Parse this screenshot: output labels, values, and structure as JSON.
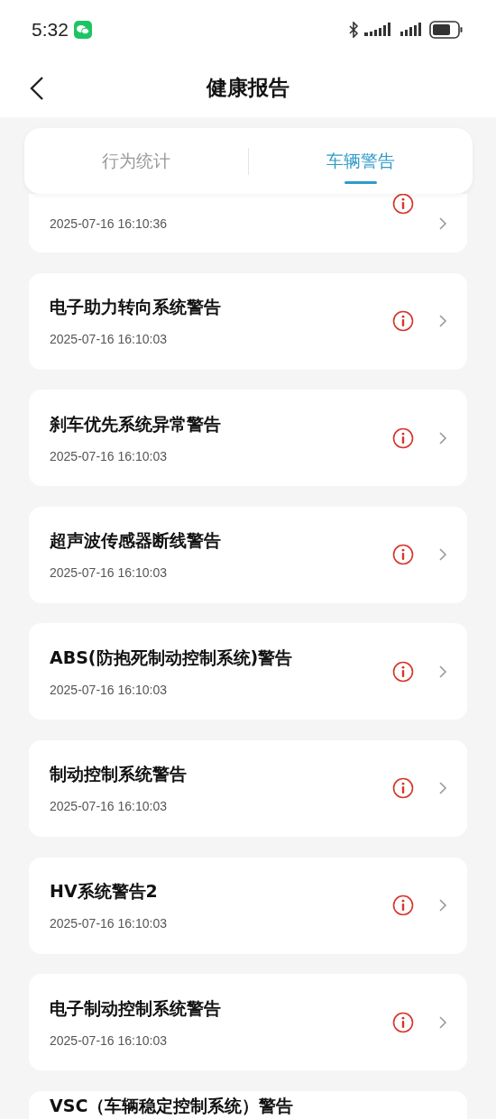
{
  "status_bar": {
    "time": "5:32"
  },
  "header": {
    "title": "健康报告"
  },
  "tabs": [
    {
      "label": "行为统计",
      "selected": false
    },
    {
      "label": "车辆警告",
      "selected": true
    }
  ],
  "warnings": [
    {
      "date": "2025-07-16 16:10:36"
    },
    {
      "title": "电子助力转向系统警告",
      "date": "2025-07-16 16:10:03"
    },
    {
      "title": "刹车优先系统异常警告",
      "date": "2025-07-16 16:10:03"
    },
    {
      "title": "超声波传感器断线警告",
      "date": "2025-07-16 16:10:03"
    },
    {
      "title": "ABS(防抱死制动控制系统)警告",
      "date": "2025-07-16 16:10:03"
    },
    {
      "title": "制动控制系统警告",
      "date": "2025-07-16 16:10:03"
    },
    {
      "title": "HV系统警告2",
      "date": "2025-07-16 16:10:03"
    },
    {
      "title": "电子制动控制系统警告",
      "date": "2025-07-16 16:10:03"
    },
    {
      "title": "VSC（车辆稳定控制系统）警告"
    }
  ]
}
